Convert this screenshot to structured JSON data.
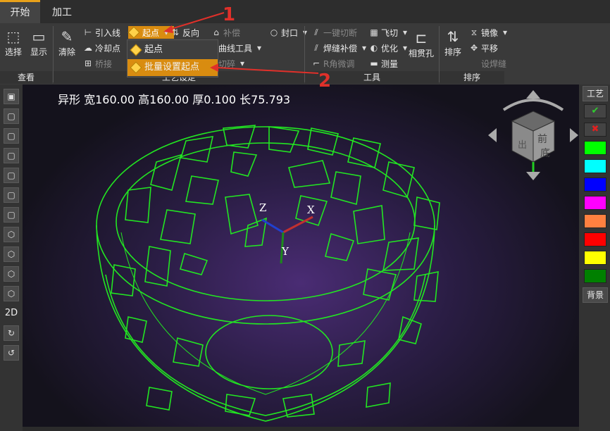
{
  "tabs": [
    {
      "label": "开始"
    },
    {
      "label": "加工"
    }
  ],
  "ribbon": {
    "groups": {
      "view": "查看",
      "craft": "工艺设定",
      "tools": "工具",
      "sort": "排序"
    },
    "select": "选择",
    "display": "显示",
    "clear": "清除",
    "lead_line": "引入线",
    "cool_point": "冷却点",
    "bridge": "桥接",
    "start_point": "起点",
    "reverse": "反向",
    "compensate": "补偿",
    "curve_tools": "曲线工具",
    "cut": "切碎",
    "seal": "封口",
    "one_key_cut": "一键切断",
    "weld_comp": "焊缝补偿",
    "r_adjust": "R角微调",
    "fly_cut": "飞切",
    "optimize": "优化",
    "measure": "测量",
    "intersect_hole": "相贯孔",
    "sort": "排序",
    "mirror": "镜像",
    "translate": "平移",
    "set_weld": "设焊缝"
  },
  "dropdown": {
    "item1": "起点",
    "item2": "批量设置起点"
  },
  "annotations": {
    "one": "1",
    "two": "2"
  },
  "viewport": {
    "info": "异形 宽160.00 高160.00 厚0.100 长75.793",
    "axis_x": "X",
    "axis_y": "Y",
    "axis_z": "Z",
    "cube_front": "前",
    "cube_bottom": "底",
    "cube_out": "出"
  },
  "left_toolbar": {
    "label_2d": "2D"
  },
  "right_toolbar": {
    "craft_label": "工艺",
    "bg_label": "背景",
    "swatches": [
      "#00ff00",
      "#00ffff",
      "#0000ff",
      "#ff00ff",
      "#ff8040",
      "#ff0000",
      "#ffff00",
      "#008000"
    ]
  },
  "colors": {
    "accent": "#d98c10",
    "mesh": "#22e622",
    "annotation": "#e0302a"
  }
}
